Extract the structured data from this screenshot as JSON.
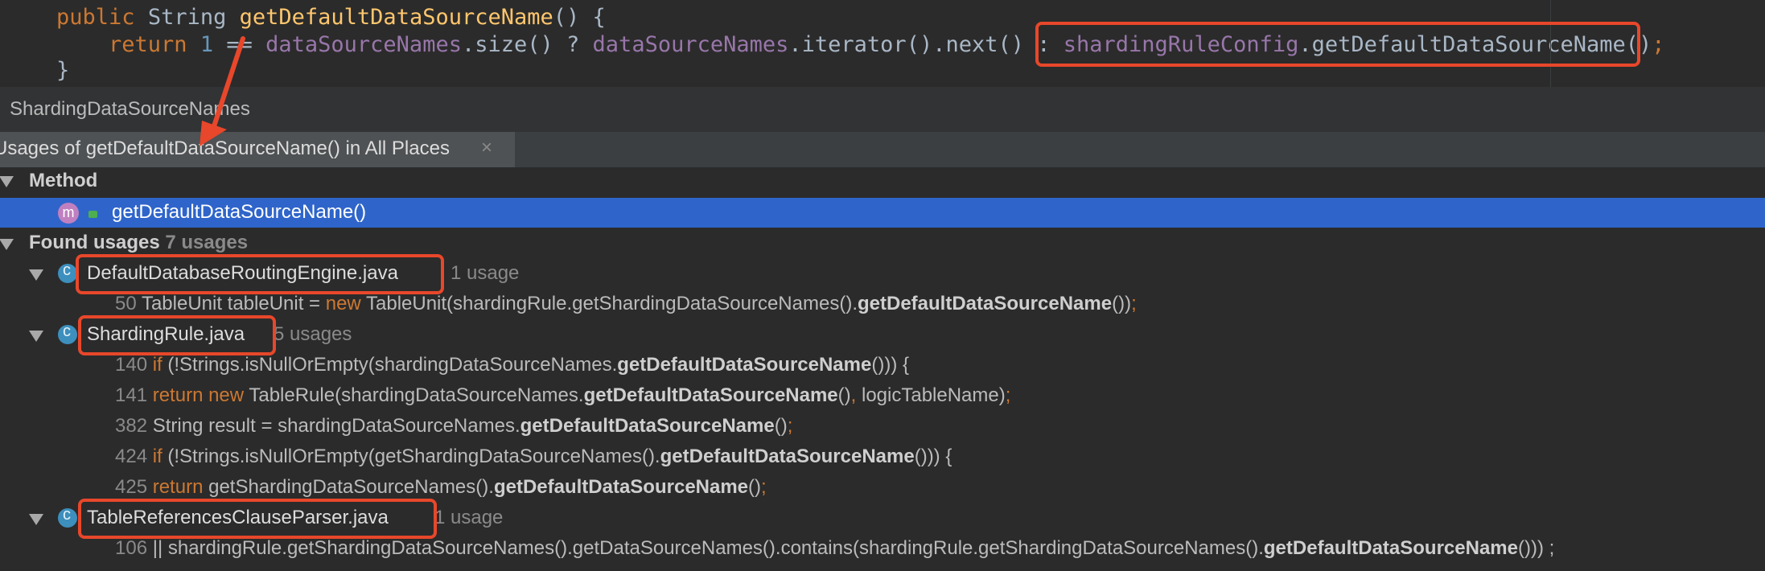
{
  "editor": {
    "line1": {
      "kw_public": "public",
      "type": "String",
      "method": "getDefaultDataSourceName",
      "rest": "() {"
    },
    "line2": {
      "kw_return": "return",
      "num": "1",
      "eq": "==",
      "field1": "dataSourceNames",
      "mid1": ".size() ?",
      "field2": "dataSourceNames",
      "mid2": ".iterator().next() :",
      "field3": "shardingRuleConfig",
      "call": ".getDefaultDataSourceName()",
      "semi": ";"
    },
    "line3": {
      "brace": "}"
    }
  },
  "breadcrumb": {
    "label": "ShardingDataSourceNames"
  },
  "tab": {
    "title": "Usages of getDefaultDataSourceName() in All Places",
    "close": "×"
  },
  "tree": {
    "method_header": "Method",
    "method_item": "getDefaultDataSourceName()",
    "found_header": "Found usages",
    "found_count": "7 usages",
    "files": [
      {
        "name": "DefaultDatabaseRoutingEngine.java",
        "count": "1 usage"
      },
      {
        "name": "ShardingRule.java",
        "count": "5 usages"
      },
      {
        "name": "TableReferencesClauseParser.java",
        "count": "1 usage"
      }
    ],
    "usages": [
      {
        "line": "50",
        "pre": "TableUnit tableUnit = ",
        "kw": "new",
        "mid": " TableUnit(shardingRule.getShardingDataSourceNames().",
        "bold": "getDefaultDataSourceName",
        "post": "())",
        "semi": ";"
      },
      {
        "line": "140",
        "kw": "if",
        "mid": " (!Strings.isNullOrEmpty(shardingDataSourceNames.",
        "bold": "getDefaultDataSourceName",
        "post": "())) {"
      },
      {
        "line": "141",
        "kw": "return new",
        "mid": " TableRule(shardingDataSourceNames.",
        "bold": "getDefaultDataSourceName",
        "post": "()",
        "comma": ",",
        "post2": " logicTableName)",
        "semi": ";"
      },
      {
        "line": "382",
        "pre": "String result = shardingDataSourceNames.",
        "bold": "getDefaultDataSourceName",
        "post": "()",
        "semi": ";"
      },
      {
        "line": "424",
        "kw": "if",
        "mid": " (!Strings.isNullOrEmpty(getShardingDataSourceNames().",
        "bold": "getDefaultDataSourceName",
        "post": "())) {"
      },
      {
        "line": "425",
        "kw": "return",
        "mid": " getShardingDataSourceNames().",
        "bold": "getDefaultDataSourceName",
        "post": "()",
        "semi": ";"
      },
      {
        "line": "106",
        "pre": "|| shardingRule.getShardingDataSourceNames().getDataSourceNames().contains(shardingRule.getShardingDataSourceNames().",
        "bold": "getDefaultDataSourceName",
        "post": "())) ;"
      }
    ]
  },
  "colors": {
    "highlight": "#e8472b",
    "selection": "#2f65ca"
  }
}
